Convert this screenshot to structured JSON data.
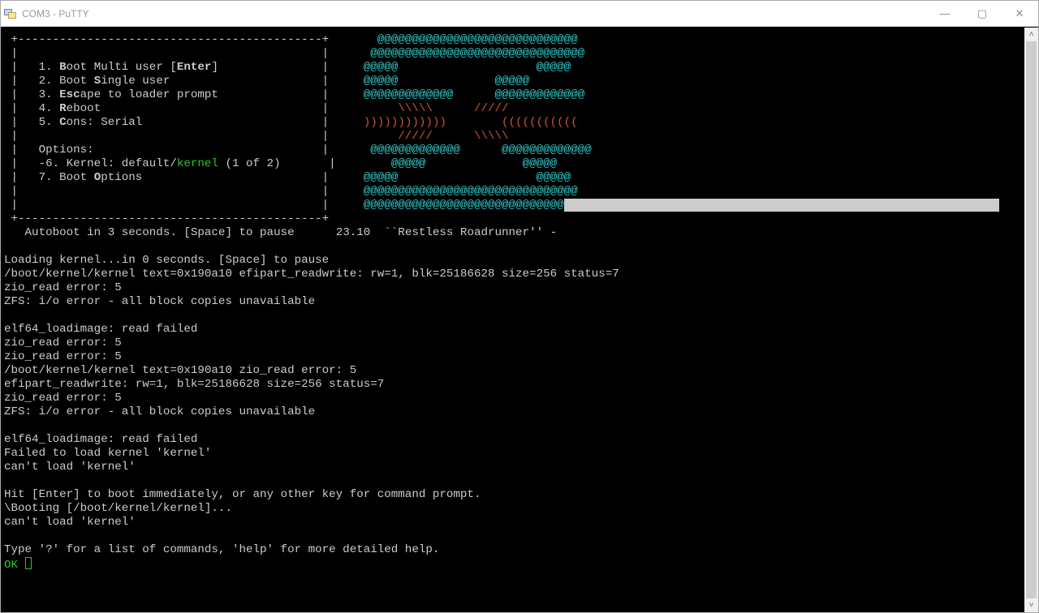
{
  "window": {
    "title": "COM3 - PuTTY"
  },
  "freebsd_menu": {
    "items": [
      {
        "n": "1",
        "label": "Boot Multi user",
        "hotkey": "B",
        "suffix": " [Enter]"
      },
      {
        "n": "2",
        "label": "Boot Single user",
        "hotkey": "S",
        "suffix": ""
      },
      {
        "n": "3",
        "label": "Escape to loader prompt",
        "hotkey": "Esc",
        "suffix": ""
      },
      {
        "n": "4",
        "label": "Reboot",
        "hotkey": "R",
        "suffix": ""
      },
      {
        "n": "5",
        "label": "Cons: Serial",
        "hotkey": "C",
        "suffix": ""
      }
    ],
    "options_label": "Options:",
    "kernel_line": {
      "n": "-6",
      "prefix": "Kernel: default/",
      "kernel": "kernel",
      "count": " (1 of 2)"
    },
    "boot_options": {
      "n": "7",
      "label": "Boot Options",
      "hotkey": "O"
    }
  },
  "logo": {
    "l01": "@@@@@@@@@@@@@@@@@@@@@@@@@@@@@",
    "l02": "@@@@@@@@@@@@@@@@@@@@@@@@@@@@@@@",
    "l03a": "@@@@@",
    "l03b": "@@@@@",
    "l04a": "@@@@@",
    "l04b": "@@@@@",
    "l05a": "@@@@@@@@@@@@@",
    "l05b": "@@@@@@@@@@@@@",
    "l06a": "\\\\\\\\\\",
    "l06b": "/////",
    "l07a": "))))))))))))",
    "l07b": "(((((((((((",
    "l08a": "/////",
    "l08b": "\\\\\\\\\\",
    "l09a": "@@@@@@@@@@@@@",
    "l09b": "@@@@@@@@@@@@@",
    "l10a": "@@@@@",
    "l10b": "@@@@@",
    "l11a": "@@@@@",
    "l11b": "@@@@@",
    "l12": "@@@@@@@@@@@@@@@@@@@@@@@@@@@@@@@",
    "l13": "@@@@@@@@@@@@@@@@@@@@@@@@@@@@@"
  },
  "autoboot": "   Autoboot in 3 seconds. [Space] to pause",
  "version": "23.10  ``Restless Roadrunner'' -",
  "log": {
    "l01": "Loading kernel...in 0 seconds. [Space] to pause",
    "l02": "/boot/kernel/kernel text=0x190a10 efipart_readwrite: rw=1, blk=25186628 size=256 status=7",
    "l03": "zio_read error: 5",
    "l04": "ZFS: i/o error - all block copies unavailable",
    "l05": "",
    "l06": "elf64_loadimage: read failed",
    "l07": "zio_read error: 5",
    "l08": "zio_read error: 5",
    "l09": "/boot/kernel/kernel text=0x190a10 zio_read error: 5",
    "l10": "efipart_readwrite: rw=1, blk=25186628 size=256 status=7",
    "l11": "zio_read error: 5",
    "l12": "ZFS: i/o error - all block copies unavailable",
    "l13": "",
    "l14": "elf64_loadimage: read failed",
    "l15": "Failed to load kernel 'kernel'",
    "l16": "can't load 'kernel'",
    "l17": "",
    "l18": "Hit [Enter] to boot immediately, or any other key for command prompt.",
    "l19": "\\Booting [/boot/kernel/kernel]...",
    "l20": "can't load 'kernel'",
    "l21": "",
    "l22": "Type '?' for a list of commands, 'help' for more detailed help."
  },
  "prompt": "OK "
}
